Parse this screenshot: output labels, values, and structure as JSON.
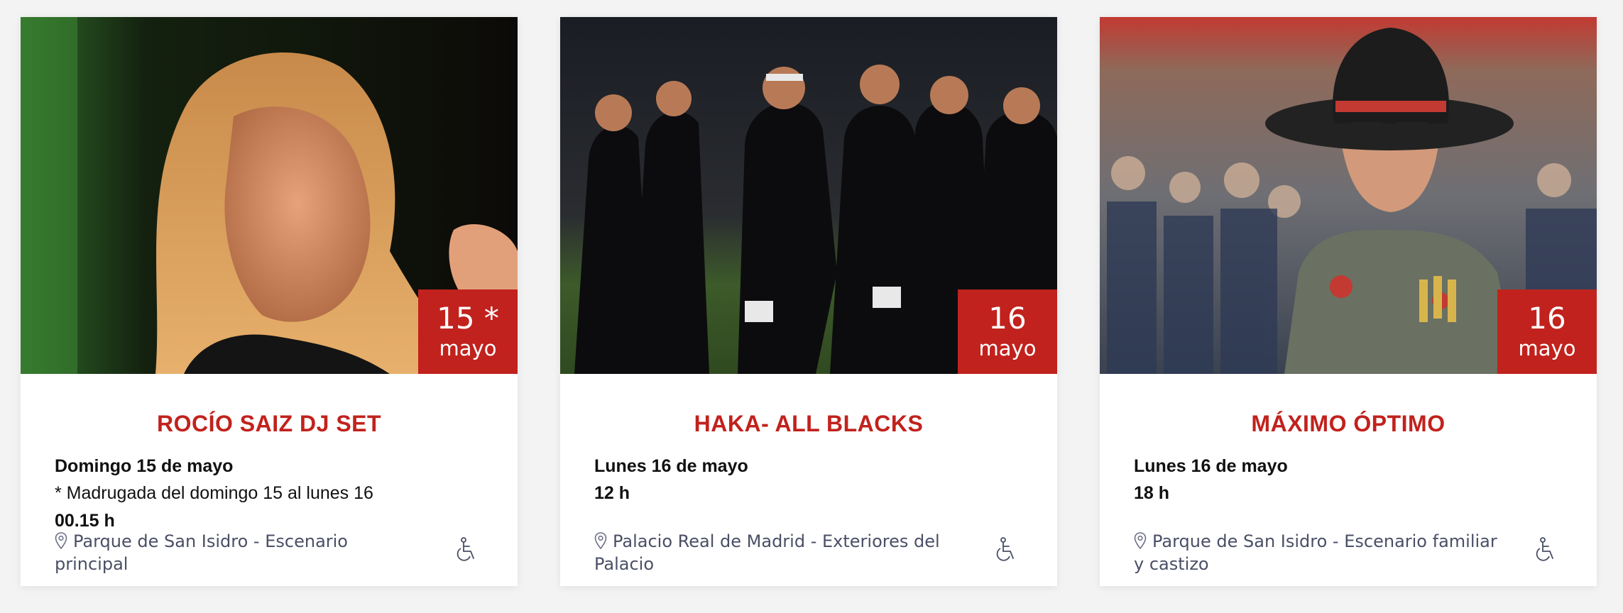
{
  "accent_color": "#c1221d",
  "events": [
    {
      "badge_day": "15 *",
      "badge_month": "mayo",
      "title": "ROCÍO SAIZ DJ SET",
      "date": "Domingo 15 de mayo",
      "note": "* Madrugada del domingo 15 al lunes 16",
      "time": "00.15 h",
      "location": "Parque de San Isidro - Escenario principal",
      "accessibility_icon": "wheelchair-icon"
    },
    {
      "badge_day": "16",
      "badge_month": "mayo",
      "title": "HAKA- ALL BLACKS",
      "date": "Lunes 16 de mayo",
      "note": "",
      "time": "12 h",
      "location": "Palacio Real de Madrid - Exteriores del Palacio",
      "accessibility_icon": "wheelchair-icon"
    },
    {
      "badge_day": "16",
      "badge_month": "mayo",
      "title": "MÁXIMO ÓPTIMO",
      "date": "Lunes 16 de mayo",
      "note": "",
      "time": "18 h",
      "location": "Parque de San Isidro - Escenario familiar y castizo",
      "accessibility_icon": "wheelchair-icon"
    }
  ]
}
